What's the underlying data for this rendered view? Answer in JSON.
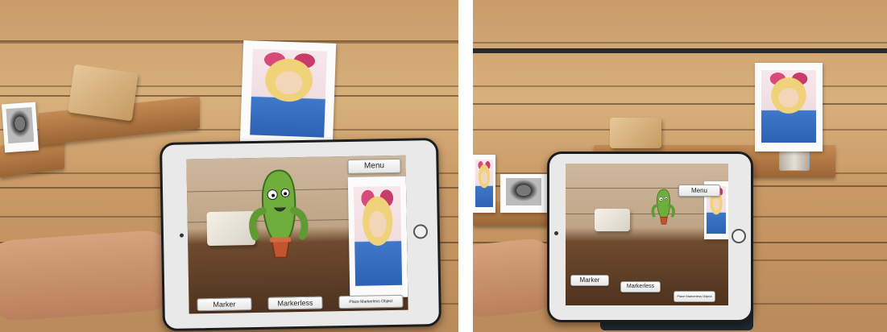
{
  "scene": {
    "description_colors": {
      "wood": "#c99c6a",
      "tablet_frame": "#e9e9e9",
      "button_bg": "#f2f2f2",
      "cactus_green": "#6fae3c",
      "pot": "#c2552d"
    }
  },
  "left_photo": {
    "app_ui": {
      "menu_label": "Menu",
      "marker_label": "Marker",
      "markerless_label": "Markerless",
      "place_label": "Place Markerless Object"
    }
  },
  "right_photo": {
    "app_ui": {
      "menu_label": "Menu",
      "marker_label": "Marker",
      "markerless_label": "Markerless",
      "place_label": "Place Markerless Object"
    }
  },
  "icons": {
    "home_button": "home-button-icon",
    "camera": "camera-icon",
    "cactus": "cactus-character-icon"
  }
}
